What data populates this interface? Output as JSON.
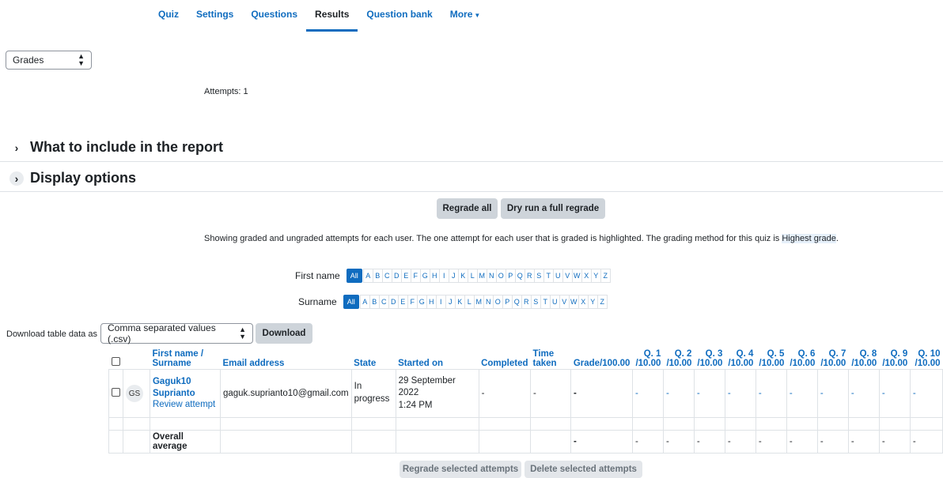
{
  "nav": {
    "tabs": [
      {
        "label": "Quiz"
      },
      {
        "label": "Settings"
      },
      {
        "label": "Questions"
      },
      {
        "label": "Results"
      },
      {
        "label": "Question bank"
      },
      {
        "label": "More"
      }
    ],
    "active": "Results"
  },
  "report_select": {
    "value": "Grades"
  },
  "attempts_text": "Attempts: 1",
  "sections": {
    "include": "What to include in the report",
    "display": "Display options"
  },
  "buttons": {
    "regrade_all": "Regrade all",
    "dry_run": "Dry run a full regrade",
    "download": "Download",
    "regrade_selected": "Regrade selected attempts",
    "delete_selected": "Delete selected attempts"
  },
  "info": {
    "text": "Showing graded and ungraded attempts for each user. The one attempt for each user that is graded is highlighted. The grading method for this quiz is",
    "method": "Highest grade",
    "end": "."
  },
  "initials": {
    "first_label": "First name",
    "surname_label": "Surname",
    "all": "All",
    "letters": [
      "A",
      "B",
      "C",
      "D",
      "E",
      "F",
      "G",
      "H",
      "I",
      "J",
      "K",
      "L",
      "M",
      "N",
      "O",
      "P",
      "Q",
      "R",
      "S",
      "T",
      "U",
      "V",
      "W",
      "X",
      "Y",
      "Z"
    ]
  },
  "download": {
    "label": "Download table data as",
    "format": "Comma separated values (.csv)"
  },
  "table": {
    "headers": {
      "name1": "First name /",
      "name2": "Surname",
      "email": "Email address",
      "state": "State",
      "started": "Started on",
      "completed": "Completed",
      "time1": "Time",
      "time2": "taken",
      "grade": "Grade/100.00"
    },
    "questions": [
      {
        "q": "Q. 1",
        "max": "/10.00"
      },
      {
        "q": "Q. 2",
        "max": "/10.00"
      },
      {
        "q": "Q. 3",
        "max": "/10.00"
      },
      {
        "q": "Q. 4",
        "max": "/10.00"
      },
      {
        "q": "Q. 5",
        "max": "/10.00"
      },
      {
        "q": "Q. 6",
        "max": "/10.00"
      },
      {
        "q": "Q. 7",
        "max": "/10.00"
      },
      {
        "q": "Q. 8",
        "max": "/10.00"
      },
      {
        "q": "Q. 9",
        "max": "/10.00"
      },
      {
        "q": "Q. 10",
        "max": "/10.00"
      }
    ],
    "row": {
      "initials": "GS",
      "first": "Gaguk10",
      "last": "Suprianto",
      "review": "Review attempt",
      "email": "gaguk.suprianto10@gmail.com",
      "state1": "In",
      "state2": "progress",
      "started1": "29 September 2022",
      "started2": "1:24 PM",
      "completed": "-",
      "time": "-",
      "grade": "-",
      "q_values": [
        "-",
        "-",
        "-",
        "-",
        "-",
        "-",
        "-",
        "-",
        "-",
        "-"
      ]
    },
    "average": {
      "label": "Overall average",
      "grade": "-",
      "q_values": [
        "-",
        "-",
        "-",
        "-",
        "-",
        "-",
        "-",
        "-",
        "-",
        "-"
      ]
    }
  }
}
